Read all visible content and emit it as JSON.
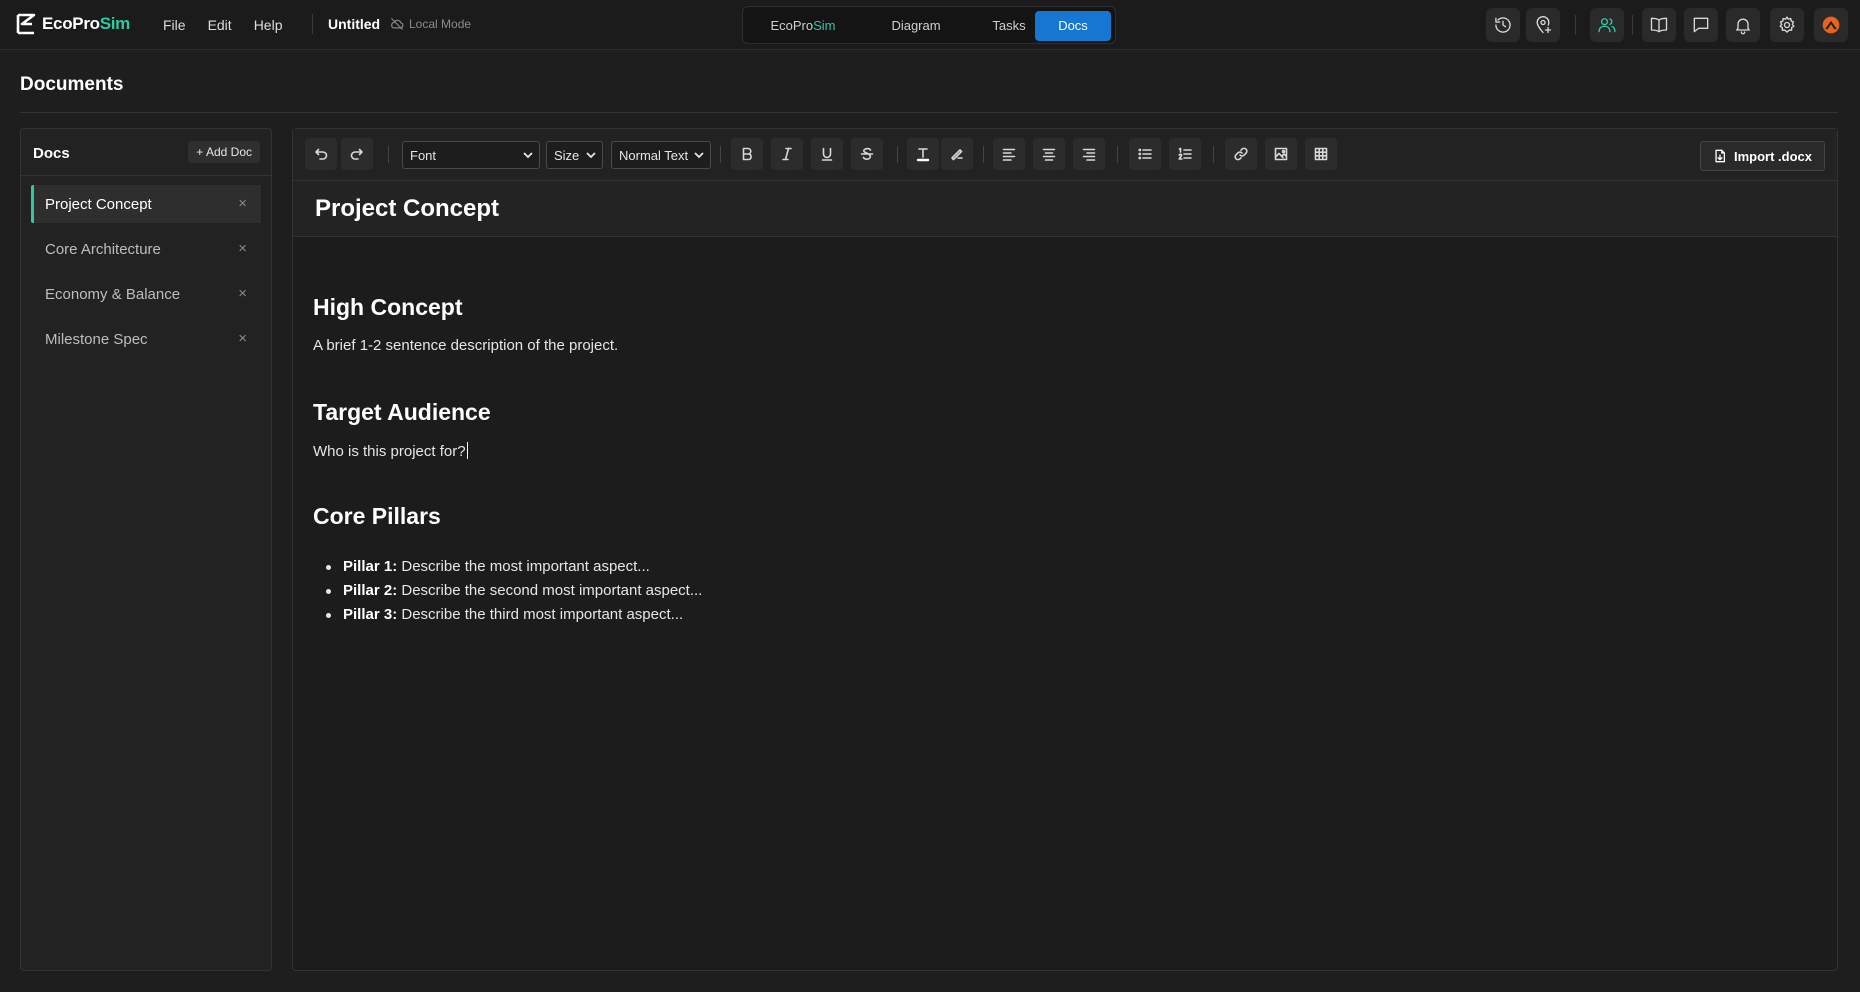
{
  "app": {
    "logo_text_1": "EcoPro",
    "logo_text_2": "Sim",
    "menu": [
      "File",
      "Edit",
      "Help"
    ],
    "doc_title": "Untitled",
    "mode_label": "Local Mode",
    "accent_color": "#2fc9a0",
    "active_tab_color": "#1677d2"
  },
  "switcher": {
    "tab1_a": "EcoPro",
    "tab1_b": "Sim",
    "tab2": "Diagram",
    "tab3": "Tasks",
    "tab4": "Docs",
    "active": "Docs"
  },
  "top_icons": [
    "history-icon",
    "location-pin-plus-icon",
    "users-icon",
    "book-icon",
    "chat-icon",
    "bell-icon",
    "gear-icon",
    "avatar-icon"
  ],
  "page": {
    "title": "Documents"
  },
  "sidebar": {
    "header": "Docs",
    "add_label": "+ Add Doc",
    "items": [
      {
        "label": "Project Concept",
        "active": true
      },
      {
        "label": "Core Architecture",
        "active": false
      },
      {
        "label": "Economy & Balance",
        "active": false
      },
      {
        "label": "Milestone Spec",
        "active": false
      }
    ],
    "close_glyph": "×"
  },
  "toolbar": {
    "font_select": "Font",
    "size_select": "Size",
    "style_select": "Normal Text",
    "import_label": "Import .docx"
  },
  "document": {
    "title": "Project Concept",
    "h_high": "High Concept",
    "p_high": "A brief 1-2 sentence description of the project.",
    "h_audience": "Target Audience",
    "p_audience": "Who is this project for?",
    "h_pillars": "Core Pillars",
    "pillars": [
      {
        "label": "Pillar 1:",
        "text": " Describe the most important aspect..."
      },
      {
        "label": "Pillar 2:",
        "text": " Describe the second most important aspect..."
      },
      {
        "label": "Pillar 3:",
        "text": " Describe the third most important aspect..."
      }
    ]
  }
}
